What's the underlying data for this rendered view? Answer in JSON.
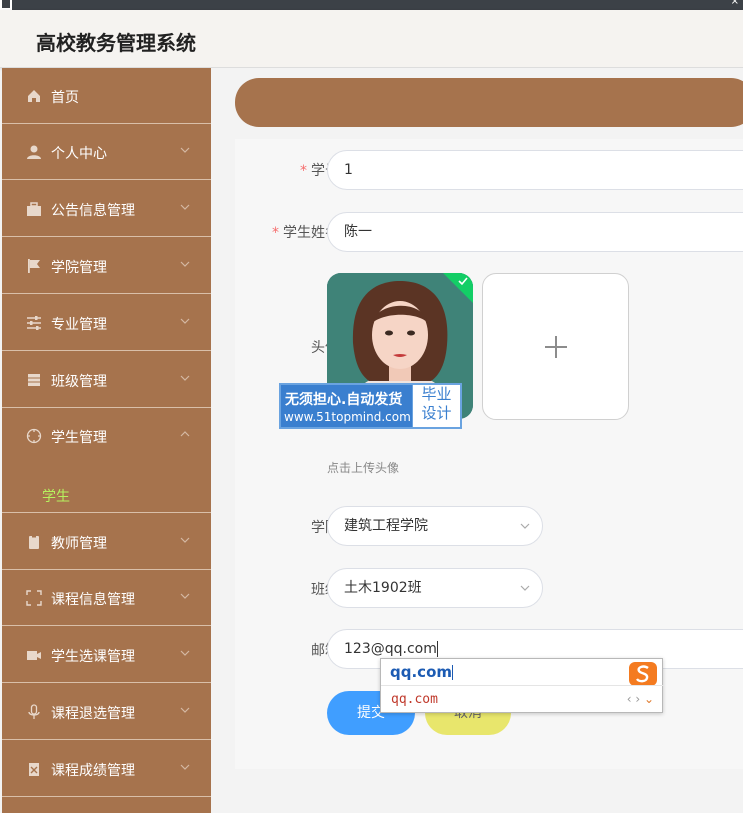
{
  "app": {
    "title": "高校教务管理系统"
  },
  "sidebar": {
    "items": [
      {
        "label": "首页",
        "icon": "home-icon"
      },
      {
        "label": "个人中心",
        "icon": "user-icon"
      },
      {
        "label": "公告信息管理",
        "icon": "briefcase-icon"
      },
      {
        "label": "学院管理",
        "icon": "flag-icon"
      },
      {
        "label": "专业管理",
        "icon": "sliders-icon"
      },
      {
        "label": "班级管理",
        "icon": "box-icon"
      },
      {
        "label": "学生管理",
        "icon": "compass-icon",
        "expanded": true
      },
      {
        "label": "教师管理",
        "icon": "clipboard-icon"
      },
      {
        "label": "课程信息管理",
        "icon": "fullscreen-icon"
      },
      {
        "label": "学生选课管理",
        "icon": "camera-icon"
      },
      {
        "label": "课程退选管理",
        "icon": "microphone-icon"
      },
      {
        "label": "课程成绩管理",
        "icon": "grade-icon"
      }
    ],
    "submenu_label": "学生"
  },
  "form": {
    "student_no": {
      "label": "学号",
      "value": "1"
    },
    "student_name": {
      "label": "学生姓名",
      "value": "陈一"
    },
    "avatar": {
      "label": "头像",
      "hint": "点击上传头像"
    },
    "college": {
      "label": "学院",
      "value": "建筑工程学院"
    },
    "class": {
      "label": "班级",
      "value": "土木1902班"
    },
    "email": {
      "label": "邮箱",
      "value": "123@qq.com"
    },
    "submit_label": "提交",
    "cancel_label": "取消"
  },
  "watermark": {
    "line1": "无须担心.自动发货",
    "line2": "www.51topmind.com",
    "side1": "毕业",
    "side2": "设计"
  },
  "ime": {
    "composition": "qq.com",
    "candidate": "qq.com"
  },
  "colors": {
    "sidebar_bg": "#a6734d",
    "submenu_active": "#b6f15e",
    "primary_button": "#409eff",
    "cancel_button": "#e8e66c",
    "required_mark": "#f56c6c"
  }
}
